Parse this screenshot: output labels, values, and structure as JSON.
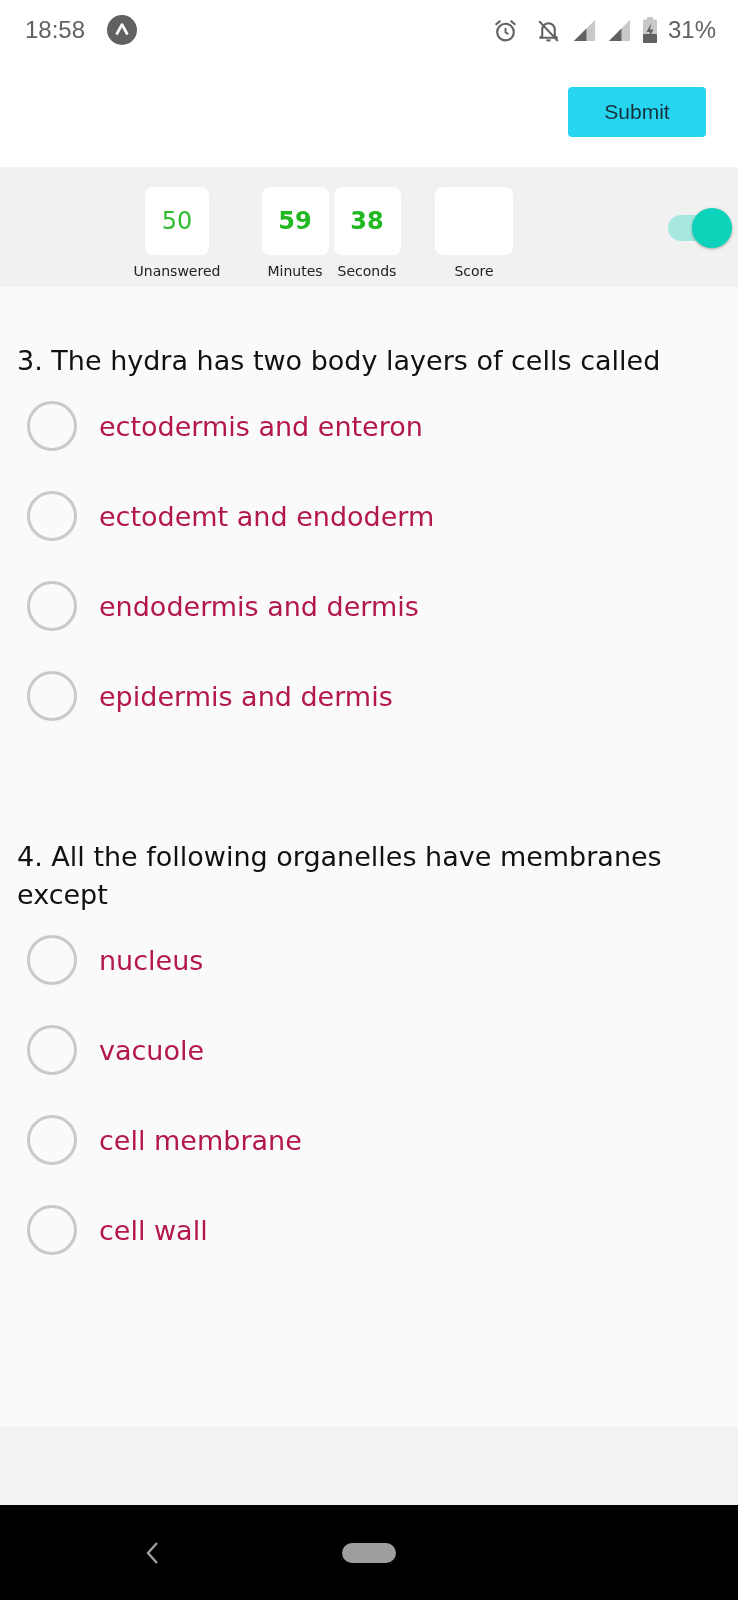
{
  "status_bar": {
    "time": "18:58",
    "battery": "31%"
  },
  "header": {
    "submit_label": "Submit"
  },
  "stats": [
    {
      "kind": "count",
      "value": "50",
      "label": "Unanswered"
    },
    {
      "kind": "timer",
      "value": "59",
      "label": "Minutes"
    },
    {
      "kind": "timer",
      "value": "38",
      "label": "Seconds"
    },
    {
      "kind": "score",
      "label": "Score"
    }
  ],
  "toggle": {
    "on": true
  },
  "questions": [
    {
      "text": "3. The hydra has two body layers of cells called",
      "options": [
        {
          "label": "ectodermis and enteron",
          "selected": false
        },
        {
          "label": "ectodemt and endoderm",
          "selected": false
        },
        {
          "label": "endodermis and dermis",
          "selected": false
        },
        {
          "label": "epidermis and dermis",
          "selected": false
        }
      ]
    },
    {
      "text": "4. All the following organelles have membranes except",
      "options": [
        {
          "label": "nucleus",
          "selected": false
        },
        {
          "label": "vacuole",
          "selected": false
        },
        {
          "label": "cell membrane",
          "selected": false
        },
        {
          "label": "cell wall",
          "selected": false
        }
      ]
    }
  ]
}
